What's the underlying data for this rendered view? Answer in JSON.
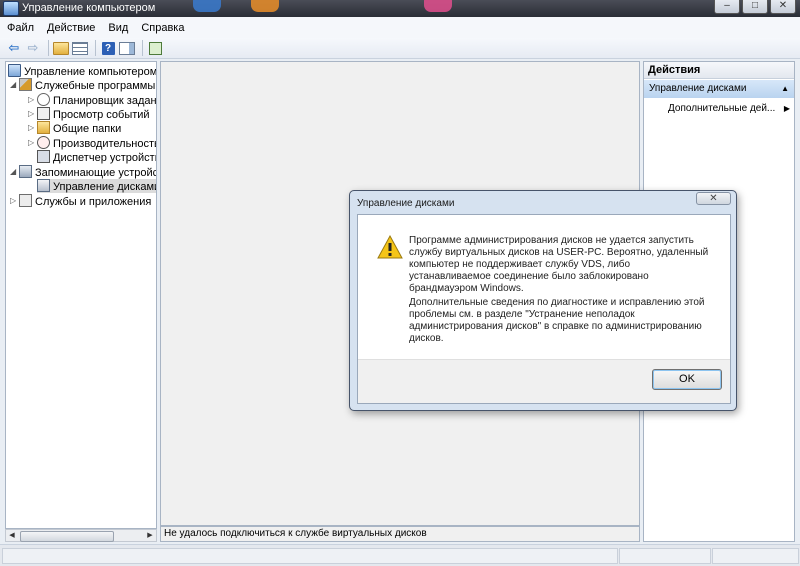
{
  "window": {
    "title": "Управление компьютером"
  },
  "menu": {
    "items": [
      "Файл",
      "Действие",
      "Вид",
      "Справка"
    ]
  },
  "tree": {
    "items": [
      {
        "label": "Управление компьютером (л",
        "icon": "computer-management-icon"
      },
      {
        "label": "Служебные программы",
        "icon": "system-tools-icon"
      },
      {
        "label": "Планировщик заданий",
        "icon": "task-scheduler-icon"
      },
      {
        "label": "Просмотр событий",
        "icon": "event-viewer-icon"
      },
      {
        "label": "Общие папки",
        "icon": "shared-folders-icon"
      },
      {
        "label": "Производительность",
        "icon": "performance-icon"
      },
      {
        "label": "Диспетчер устройств",
        "icon": "device-manager-icon"
      },
      {
        "label": "Запоминающие устройст",
        "icon": "storage-icon"
      },
      {
        "label": "Управление дисками",
        "icon": "disk-management-icon"
      },
      {
        "label": "Службы и приложения",
        "icon": "services-icon"
      }
    ]
  },
  "center": {
    "status": "Не удалось подключиться к службе виртуальных дисков"
  },
  "actions": {
    "header": "Действия",
    "section": "Управление дисками",
    "item": "Дополнительные дей..."
  },
  "dialog": {
    "title": "Управление дисками",
    "message1": "Программе администрирования дисков не удается запустить службу виртуальных дисков на USER-PC. Вероятно, удаленный компьютер не поддерживает службу VDS, либо устанавливаемое соединение было заблокировано брандмауэром Windows.",
    "message2": "Дополнительные сведения по диагностике и исправлению этой проблемы см. в разделе \"Устранение неполадок администрирования дисков\" в справке по администрированию дисков.",
    "ok_label": "OK"
  }
}
